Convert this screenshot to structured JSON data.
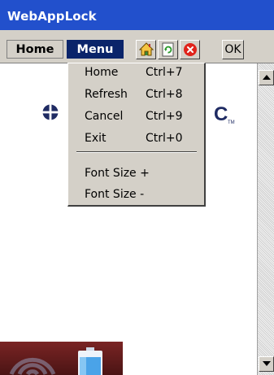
{
  "window": {
    "title": "WebAppLock"
  },
  "menubar": {
    "home_label": "Home",
    "menu_label": "Menu",
    "ok_label": "OK"
  },
  "toolbar_icons": [
    "home-icon",
    "refresh-icon",
    "close-icon"
  ],
  "dropdown": {
    "items": [
      {
        "label": "Home",
        "shortcut": "Ctrl+7"
      },
      {
        "label": "Refresh",
        "shortcut": "Ctrl+8"
      },
      {
        "label": "Cancel",
        "shortcut": "Ctrl+9"
      },
      {
        "label": "Exit",
        "shortcut": "Ctrl+0"
      },
      {
        "label": "Font Size +",
        "shortcut": ""
      },
      {
        "label": "Font Size -",
        "shortcut": ""
      }
    ]
  },
  "logo": {
    "visible_letter": "C",
    "trademark": "TM"
  },
  "colors": {
    "titlebar": "#2250cc",
    "menu_highlight": "#0a246a",
    "chrome": "#d4d0c8",
    "close_red": "#e0231b",
    "logo_navy": "#1f2b63"
  }
}
